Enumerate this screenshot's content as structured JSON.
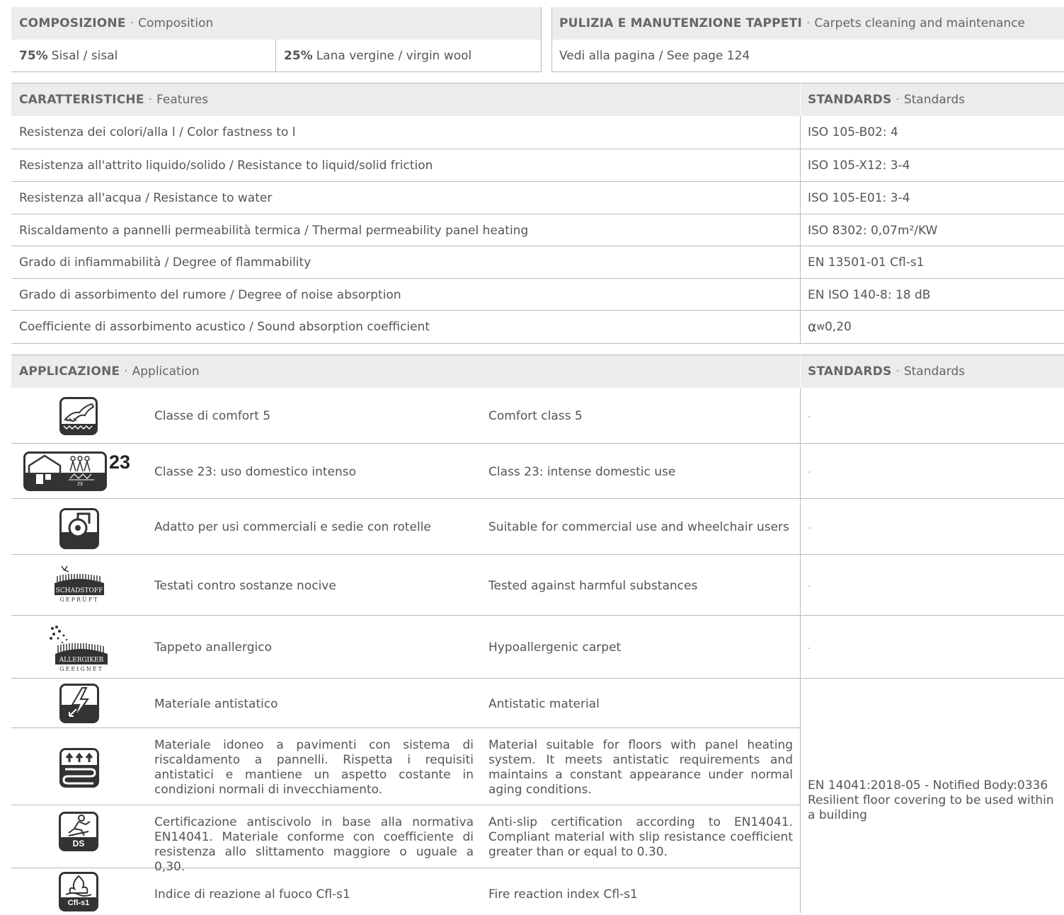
{
  "composition": {
    "title": "COMPOSIZIONE",
    "title_en": "Composition",
    "items": [
      {
        "pct": "75%",
        "label": "Sisal / sisal"
      },
      {
        "pct": "25%",
        "label": "Lana vergine / virgin wool"
      }
    ]
  },
  "cleaning": {
    "title": "PULIZIA E MANUTENZIONE TAPPETI",
    "title_en": "Carpets cleaning and maintenance",
    "text": "Vedi alla pagina / See page 124"
  },
  "features": {
    "title": "CARATTERISTICHE",
    "title_en": "Features",
    "std_title": "STANDARDS",
    "std_title_en": "Standards",
    "rows": [
      {
        "label": "Resistenza dei colori/alla l / Color fastness to l",
        "std": "ISO 105-B02: 4"
      },
      {
        "label": "Resistenza all'attrito liquido/solido / Resistance to liquid/solid friction",
        "std": "ISO 105-X12: 3-4"
      },
      {
        "label": "Resistenza all'acqua / Resistance to water",
        "std": "ISO 105-E01: 3-4"
      },
      {
        "label": "Riscaldamento a pannelli permeabilità termica / Thermal permeability panel heating",
        "std": "ISO 8302: 0,07m²/KW"
      },
      {
        "label": "Grado di infiammabilità / Degree of flammability",
        "std": "EN 13501-01 Cfl-s1"
      },
      {
        "label": "Grado di assorbimento del rumore / Degree of noise absorption",
        "std": "EN ISO 140-8: 18 dB"
      },
      {
        "label": "Coefficiente di assorbimento acustico / Sound absorption coefficient",
        "std_alpha": "α",
        "std_sub": "w",
        "std_rest": " 0,20"
      }
    ]
  },
  "application": {
    "title": "APPLICAZIONE",
    "title_en": "Application",
    "std_title": "STANDARDS",
    "std_title_en": "Standards",
    "rows": [
      {
        "icon": "comfort-class-icon",
        "it": "Classe di comfort 5",
        "en": "Comfort class 5",
        "std": "-"
      },
      {
        "icon": "domestic-use-class-icon",
        "icon_num": "23",
        "icon_small": "23",
        "it": "Classe 23: uso domestico intenso",
        "en": "Class 23: intense domestic use",
        "std": "-"
      },
      {
        "icon": "castor-chair-icon",
        "it": "Adatto per usi commerciali e sedie con rotelle",
        "en": "Suitable for commercial use and wheelchair users",
        "std": "-"
      },
      {
        "icon": "schadstoff-geprueft-icon",
        "icon_text1": "SCHADSTOFF",
        "icon_text2": "GEPRÜFT",
        "it": "Testati contro sostanze nocive",
        "en": "Tested against harmful substances",
        "std": "-"
      },
      {
        "icon": "allergiker-geeignet-icon",
        "icon_text1": "ALLERGIKER",
        "icon_text2": "GEEIGNET",
        "it": "Tappeto anallergico",
        "en": "Hypoallergenic carpet",
        "std": "-"
      },
      {
        "icon": "antistatic-icon",
        "it": "Materiale antistatico",
        "en": "Antistatic material"
      },
      {
        "icon": "floor-heating-icon",
        "it": "Materiale idoneo a pavimenti con sistema di riscaldamento a pannelli. Rispetta i requisiti antistatici e mantiene un aspetto costante in condizioni normali di invecchiamento.",
        "en": "Material suitable for floors with panel heating system. It meets antistatic requirements and maintains a constant appearance under normal aging conditions."
      },
      {
        "icon": "anti-slip-icon",
        "icon_label": "DS",
        "it": "Certificazione antiscivolo in base alla normativa EN14041. Materiale conforme con coefficiente di resistenza allo slittamento maggiore o uguale a 0,30.",
        "en": "Anti-slip certification according to EN14041. Compliant material with slip resistance coefficient greater than or equal to 0.30."
      },
      {
        "icon": "fire-reaction-icon",
        "icon_label": "Cfl-s1",
        "it": "Indice di reazione al fuoco Cfl-s1",
        "en": "Fire reaction index Cfl-s1"
      }
    ],
    "merged_std": "EN 14041:2018-05 - Notified Body:0336 Resilient floor covering to be used within a building"
  }
}
